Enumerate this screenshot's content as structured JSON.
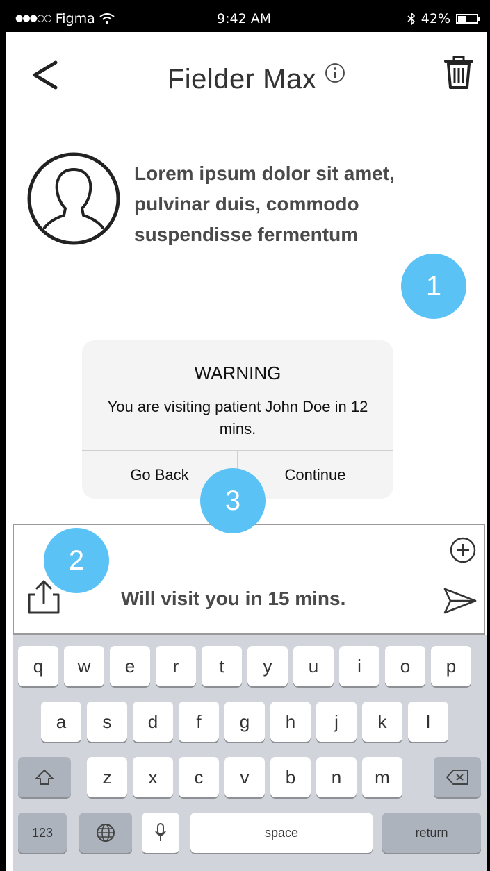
{
  "status_bar": {
    "carrier": "Figma",
    "signal_dots": "●●●○○",
    "time": "9:42 AM",
    "battery": "42%",
    "battery_level": 0.42,
    "icons": [
      "wifi-icon",
      "bluetooth-icon",
      "battery-icon"
    ]
  },
  "nav": {
    "title": "Fielder Max",
    "icons": [
      "back-chevron-icon",
      "info-icon",
      "trash-icon"
    ]
  },
  "contact": {
    "avatar_icon": "person-outline-icon",
    "text": "Lorem ipsum dolor sit amet, pulvinar duis, commodo suspendisse fermentum"
  },
  "badges": [
    "1",
    "2",
    "3"
  ],
  "badge_color": "#5bc2f5",
  "alert": {
    "title": "WARNING",
    "message": "You are visiting patient John Doe in 12 mins.",
    "buttons": [
      "Go Back",
      "Continue"
    ]
  },
  "composer": {
    "message": "Will visit you in 15 mins.",
    "icons": [
      "plus-circle-icon",
      "share-icon",
      "send-icon"
    ]
  },
  "keyboard": {
    "row1": [
      "q",
      "w",
      "e",
      "r",
      "t",
      "y",
      "u",
      "i",
      "o",
      "p"
    ],
    "row2": [
      "a",
      "s",
      "d",
      "f",
      "g",
      "h",
      "j",
      "k",
      "l"
    ],
    "row3": [
      "z",
      "x",
      "c",
      "v",
      "b",
      "n",
      "m"
    ],
    "numbers_key": "123",
    "space_key": "space",
    "return_key": "return",
    "icons": [
      "shift-icon",
      "backspace-icon",
      "globe-icon",
      "microphone-icon"
    ]
  }
}
